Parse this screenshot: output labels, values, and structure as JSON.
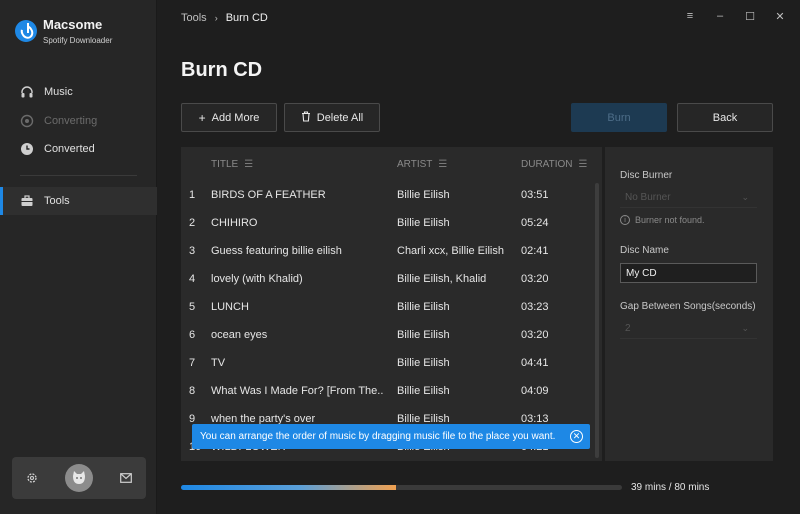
{
  "app": {
    "name": "Macsome",
    "subtitle": "Spotify Downloader",
    "brand_color": "#1e88e5"
  },
  "sidebar": {
    "items": [
      {
        "label": "Music",
        "icon": "headphones-icon",
        "state": "normal"
      },
      {
        "label": "Converting",
        "icon": "converting-icon",
        "state": "disabled"
      },
      {
        "label": "Converted",
        "icon": "clock-icon",
        "state": "normal"
      },
      {
        "label": "Tools",
        "icon": "toolbox-icon",
        "state": "active"
      }
    ]
  },
  "breadcrumb": {
    "parent": "Tools",
    "current": "Burn CD"
  },
  "page": {
    "title": "Burn CD"
  },
  "toolbar": {
    "add_more": "Add More",
    "delete_all": "Delete All",
    "burn": "Burn",
    "back": "Back"
  },
  "table": {
    "headers": {
      "title": "TITLE",
      "artist": "ARTIST",
      "duration": "DURATION"
    },
    "rows": [
      {
        "num": "1",
        "title": "BIRDS OF A FEATHER",
        "artist": "Billie Eilish",
        "duration": "03:51"
      },
      {
        "num": "2",
        "title": "CHIHIRO",
        "artist": "Billie Eilish",
        "duration": "05:24"
      },
      {
        "num": "3",
        "title": "Guess featuring billie eilish",
        "artist": "Charli xcx, Billie Eilish",
        "duration": "02:41"
      },
      {
        "num": "4",
        "title": "lovely (with Khalid)",
        "artist": "Billie Eilish, Khalid",
        "duration": "03:20"
      },
      {
        "num": "5",
        "title": "LUNCH",
        "artist": "Billie Eilish",
        "duration": "03:23"
      },
      {
        "num": "6",
        "title": "ocean eyes",
        "artist": "Billie Eilish",
        "duration": "03:20"
      },
      {
        "num": "7",
        "title": "TV",
        "artist": "Billie Eilish",
        "duration": "04:41"
      },
      {
        "num": "8",
        "title": "What Was I Made For? [From The...",
        "artist": "Billie Eilish",
        "duration": "04:09"
      },
      {
        "num": "9",
        "title": "when the party's over",
        "artist": "Billie Eilish",
        "duration": "03:13"
      },
      {
        "num": "10",
        "title": "WILDFLOWER",
        "artist": "Billie Eilish",
        "duration": "04:21"
      }
    ]
  },
  "toast": {
    "message": "You can arrange the order of music by dragging music file to the place you want."
  },
  "settings": {
    "disc_burner_label": "Disc Burner",
    "disc_burner_value": "No Burner",
    "burner_hint": "Burner not found.",
    "disc_name_label": "Disc Name",
    "disc_name_value": "My CD",
    "gap_label": "Gap Between Songs(seconds)",
    "gap_value": "2"
  },
  "progress": {
    "text": "39 mins / 80 mins",
    "used_minutes": 39,
    "total_minutes": 80
  }
}
